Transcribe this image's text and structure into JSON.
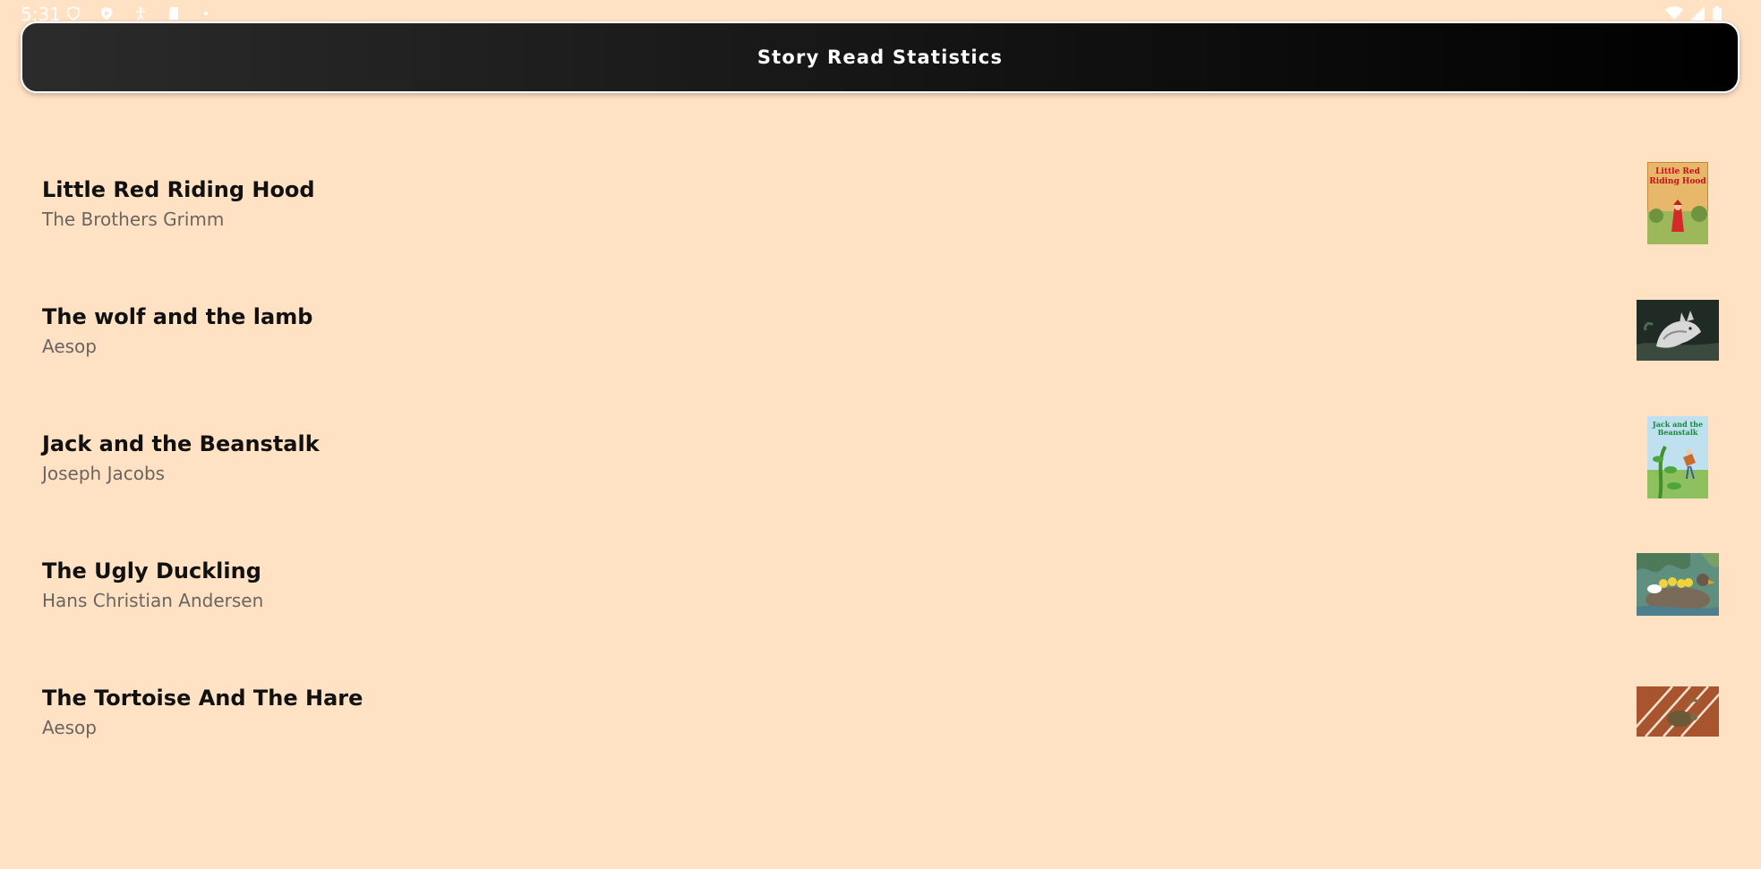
{
  "status_bar": {
    "time": "5:31",
    "icons": [
      "shield-icon",
      "play-shield-icon",
      "accessibility-icon",
      "sd-card-icon",
      "dot-icon",
      "wifi-icon",
      "signal-icon",
      "battery-icon"
    ]
  },
  "header": {
    "title": "Story Read Statistics"
  },
  "stories": [
    {
      "title": "Little Red Riding Hood",
      "author": "The Brothers Grimm",
      "cover": "little-red-riding-hood-cover",
      "cover_text": "Little Red Riding Hood"
    },
    {
      "title": "The wolf and the lamb",
      "author": "Aesop",
      "cover": "wolf-image"
    },
    {
      "title": "Jack and the Beanstalk",
      "author": "Joseph Jacobs",
      "cover": "jack-and-the-beanstalk-cover",
      "cover_text": "Jack and the Beanstalk"
    },
    {
      "title": "The Ugly Duckling",
      "author": "Hans Christian Andersen",
      "cover": "ducklings-image"
    },
    {
      "title": "The Tortoise And The Hare",
      "author": "Aesop",
      "cover": "tortoise-race-track-image"
    }
  ],
  "colors": {
    "background": "#ffe1c4",
    "header_bg": "#1a1a1a",
    "title_text": "#111111",
    "author_text": "#6b6560"
  }
}
